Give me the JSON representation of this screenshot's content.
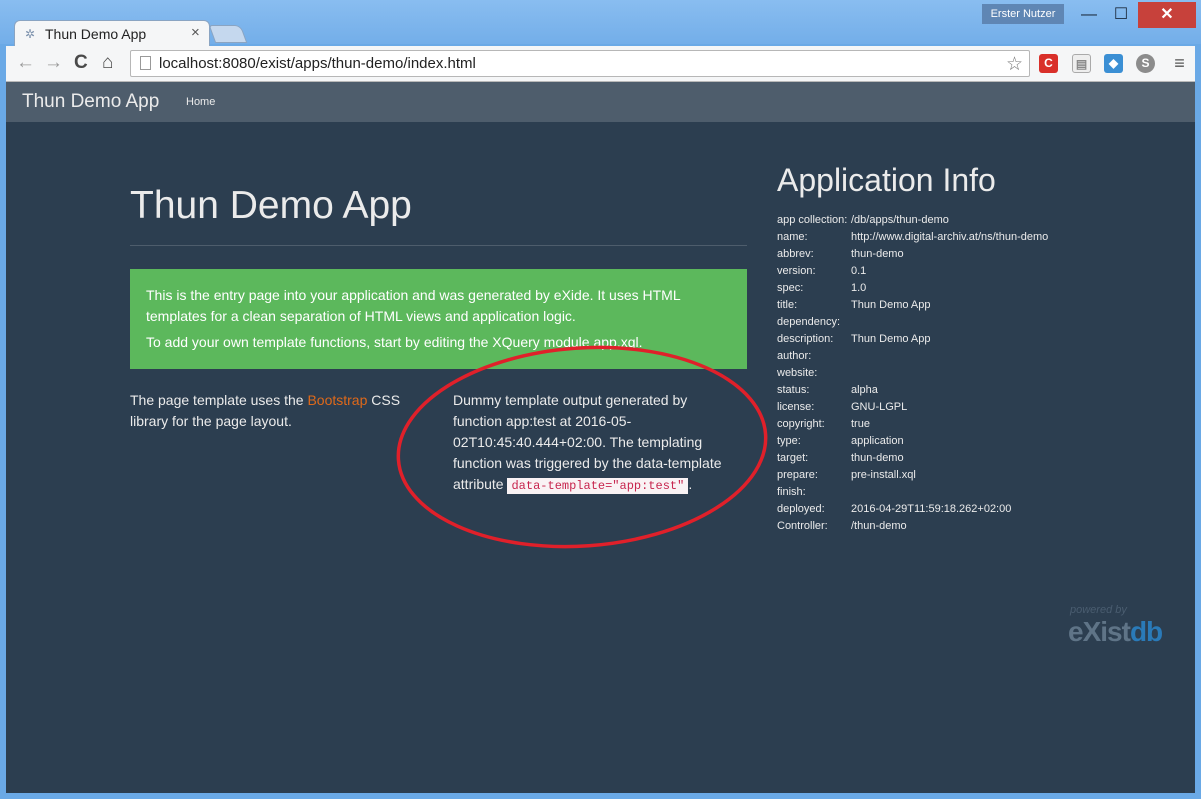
{
  "window": {
    "user_badge": "Erster Nutzer",
    "minimize": "—",
    "maximize": "☐",
    "close": "✕"
  },
  "tab": {
    "title": "Thun Demo App",
    "close": "×"
  },
  "toolbar": {
    "back": "←",
    "forward": "→",
    "reload": "C",
    "home": "⌂",
    "url": "localhost:8080/exist/apps/thun-demo/index.html",
    "star": "☆",
    "ext_c": "C",
    "ext_doc": "▤",
    "ext_cube": "◆",
    "ext_s": "S",
    "menu": "≡"
  },
  "navbar": {
    "brand": "Thun Demo App",
    "home": "Home"
  },
  "main": {
    "title": "Thun Demo App",
    "alert_p1": "This is the entry page into your application and was generated by eXide. It uses HTML templates for a clean separation of HTML views and application logic.",
    "alert_p2": "To add your own template functions, start by editing the XQuery module app.xql.",
    "left_pre": "The page template uses the ",
    "left_link": "Bootstrap",
    "left_post": " CSS library for the page layout.",
    "mid_text": "Dummy template output generated by function app:test at 2016-05-02T10:45:40.444+02:00. The templating function was triggered by the data-template attribute ",
    "mid_code": "data-template=\"app:test\"",
    "mid_end": "."
  },
  "info": {
    "title": "Application Info",
    "rows": [
      {
        "k": "app collection:",
        "v": "/db/apps/thun-demo"
      },
      {
        "k": "name:",
        "v": "http://www.digital-archiv.at/ns/thun-demo"
      },
      {
        "k": "abbrev:",
        "v": "thun-demo"
      },
      {
        "k": "version:",
        "v": "0.1"
      },
      {
        "k": "spec:",
        "v": "1.0"
      },
      {
        "k": "title:",
        "v": "Thun Demo App"
      },
      {
        "k": "dependency:",
        "v": ""
      },
      {
        "k": "description:",
        "v": "Thun Demo App"
      },
      {
        "k": "author:",
        "v": ""
      },
      {
        "k": "website:",
        "v": ""
      },
      {
        "k": "status:",
        "v": "alpha"
      },
      {
        "k": "license:",
        "v": "GNU-LGPL"
      },
      {
        "k": "copyright:",
        "v": "true"
      },
      {
        "k": "type:",
        "v": "application"
      },
      {
        "k": "target:",
        "v": "thun-demo"
      },
      {
        "k": "prepare:",
        "v": "pre-install.xql"
      },
      {
        "k": "finish:",
        "v": ""
      },
      {
        "k": "deployed:",
        "v": "2016-04-29T11:59:18.262+02:00"
      },
      {
        "k": "Controller:",
        "v": "/thun-demo"
      }
    ]
  },
  "footer": {
    "powered_by": "powered by",
    "logo_e": "eXist",
    "logo_db": "db"
  }
}
